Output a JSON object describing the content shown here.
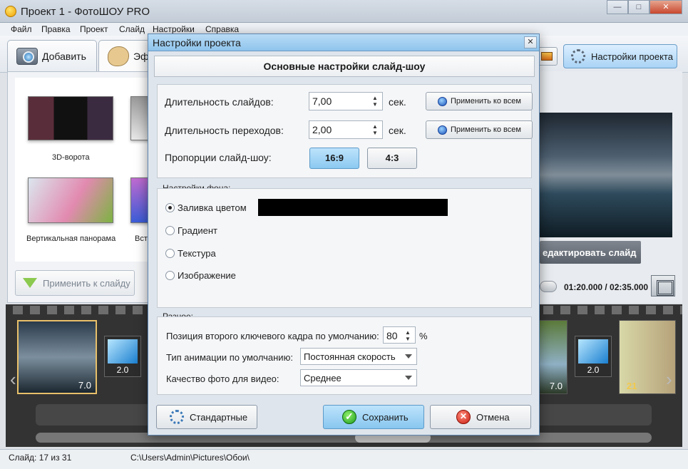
{
  "window": {
    "title": "Проект 1 - ФотоШОУ PRO",
    "minimize": "—",
    "maximize": "□",
    "close": "✕"
  },
  "menu": [
    "Файл",
    "Правка",
    "Проект",
    "Слайд",
    "Настройки",
    "Справка"
  ],
  "toolbar": {
    "add_tab": "Добавить",
    "effects_tab": "Эф",
    "project_settings": "Настройки проекта"
  },
  "effects": {
    "items": [
      {
        "label": "3D-ворота"
      },
      {
        "label": "Вертикальная панорама"
      },
      {
        "label": "Вст"
      }
    ],
    "apply_to_slide": "Применить к слайду"
  },
  "preview": {
    "edit_slide": "едактировать слайд",
    "time": "01:20.000 / 02:35.000"
  },
  "filmstrip": {
    "frames": [
      {
        "num": "7.0"
      },
      {
        "num": "2.0"
      },
      {
        "num": "7.0"
      },
      {
        "num": "2.0"
      },
      {
        "num": "21"
      }
    ]
  },
  "status": {
    "slide": "Слайд: 17 из 31",
    "path": "C:\\Users\\Admin\\Pictures\\Обои\\"
  },
  "dialog": {
    "title": "Настройки проекта",
    "close": "✕",
    "header": "Основные настройки слайд-шоу",
    "slide_duration_label": "Длительность слайдов:",
    "slide_duration_value": "7,00",
    "transition_duration_label": "Длительность переходов:",
    "transition_duration_value": "2,00",
    "unit": "сек.",
    "apply_all": "Применить ко всем",
    "aspect_label": "Пропорции слайд-шоу:",
    "aspect_16_9": "16:9",
    "aspect_4_3": "4:3",
    "bg_section": "Настройки фона:",
    "bg_options": [
      "Заливка цветом",
      "Градиент",
      "Текстура",
      "Изображение"
    ],
    "bg_selected_index": 0,
    "bg_color": "#000000",
    "misc_section": "Разное:",
    "keyframe_label": "Позиция второго ключевого кадра по умолчанию:",
    "keyframe_value": "80",
    "percent": "%",
    "anim_label": "Тип анимации по умолчанию:",
    "anim_value": "Постоянная скорость",
    "quality_label": "Качество фото для видео:",
    "quality_value": "Среднее",
    "defaults_button": "Стандартные",
    "save_button": "Сохранить",
    "cancel_button": "Отмена"
  }
}
